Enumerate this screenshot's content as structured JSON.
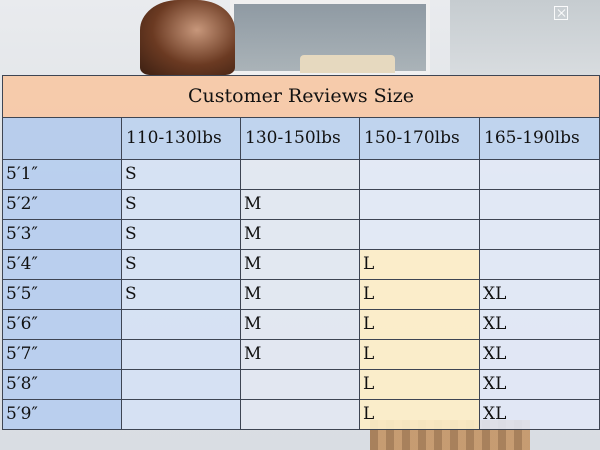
{
  "title": "Customer Reviews Size",
  "columns": [
    "110-130lbs",
    "130-150lbs",
    "150-170lbs",
    "165-190lbs"
  ],
  "rows": [
    {
      "height": "5′1″",
      "sizes": [
        "S",
        "",
        "",
        ""
      ]
    },
    {
      "height": "5′2″",
      "sizes": [
        "S",
        "M",
        "",
        ""
      ]
    },
    {
      "height": "5′3″",
      "sizes": [
        "S",
        "M",
        "",
        ""
      ]
    },
    {
      "height": "5′4″",
      "sizes": [
        "S",
        "M",
        "L",
        ""
      ]
    },
    {
      "height": "5′5″",
      "sizes": [
        "S",
        "M",
        "L",
        "XL"
      ]
    },
    {
      "height": "5′6″",
      "sizes": [
        "",
        "M",
        "L",
        "XL"
      ]
    },
    {
      "height": "5′7″",
      "sizes": [
        "",
        "M",
        "L",
        "XL"
      ]
    },
    {
      "height": "5′8″",
      "sizes": [
        "",
        "",
        "L",
        "XL"
      ]
    },
    {
      "height": "5′9″",
      "sizes": [
        "",
        "",
        "L",
        "XL"
      ]
    }
  ],
  "colors": {
    "title_bg": "#f8c8a6",
    "header_bg": "#bdd3ee",
    "height_col_bg": "#b6cdee",
    "highlight_bg": "#fdeec8",
    "border": "#3e4553"
  },
  "icons": {
    "corner_button": "close-icon"
  }
}
